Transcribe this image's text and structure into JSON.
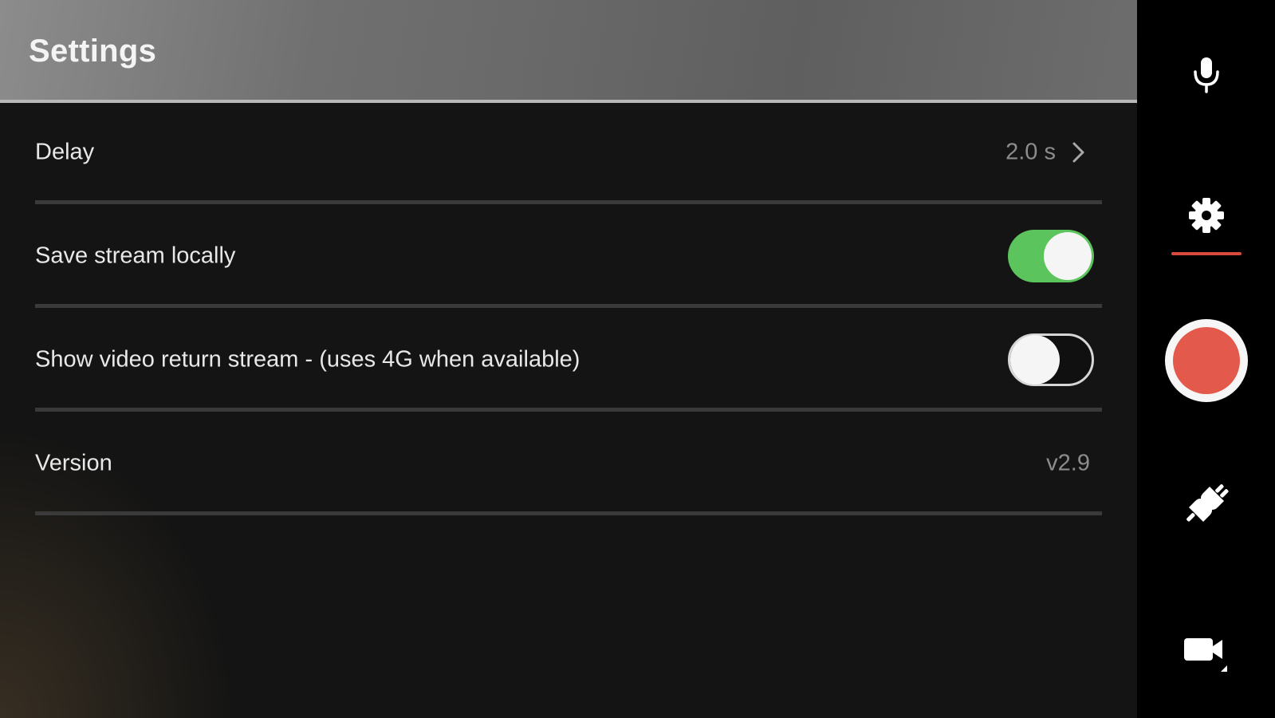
{
  "header": {
    "title": "Settings"
  },
  "settings": {
    "delay": {
      "label": "Delay",
      "value": "2.0 s"
    },
    "save_stream": {
      "label": "Save stream locally",
      "enabled": true
    },
    "video_return": {
      "label": "Show video return stream - (uses 4G when available)",
      "enabled": false
    },
    "version": {
      "label": "Version",
      "value": "v2.9"
    }
  },
  "toolbar": {
    "items": [
      {
        "icon": "microphone-icon"
      },
      {
        "icon": "gear-icon",
        "selected": true
      },
      {
        "icon": "record-icon"
      },
      {
        "icon": "plug-icon"
      },
      {
        "icon": "video-camera-icon"
      }
    ]
  },
  "colors": {
    "toggle_on": "#5cc45c",
    "record": "#e35a4c",
    "selected_underline": "#d84a3d",
    "header_border": "#b9b9b9"
  }
}
